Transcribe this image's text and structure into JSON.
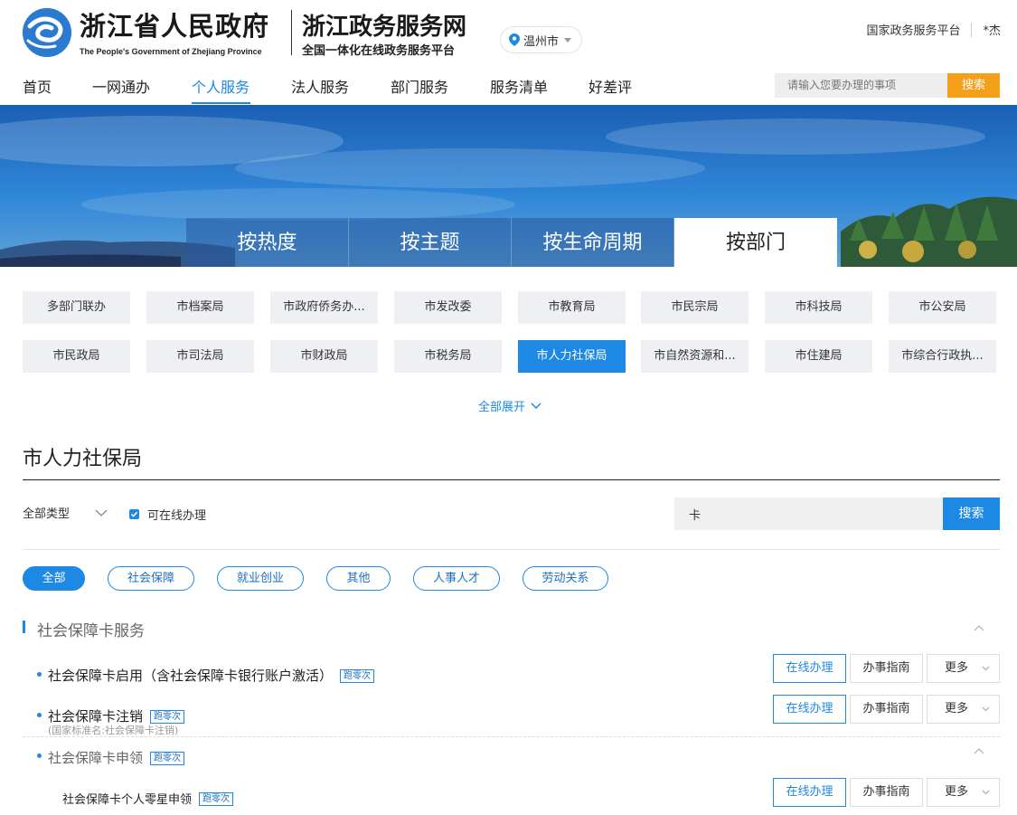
{
  "header": {
    "gov_name": "浙江省人民政府",
    "gov_name_en": "The People's Government of Zhejiang Province",
    "site_name": "浙江政务服务网",
    "site_slogan": "全国一体化在线政务服务平台",
    "city": "温州市",
    "links": [
      "国家政务服务平台",
      "*杰"
    ]
  },
  "nav": {
    "items": [
      "首页",
      "一网通办",
      "个人服务",
      "法人服务",
      "部门服务",
      "服务清单",
      "好差评"
    ],
    "active": "个人服务",
    "search_placeholder": "请输入您要办理的事项",
    "search_button": "搜索"
  },
  "banner_tabs": [
    "按热度",
    "按主题",
    "按生命周期",
    "按部门"
  ],
  "banner_active": "按部门",
  "departments": [
    "多部门联办",
    "市档案局",
    "市政府侨务办...",
    "市发改委",
    "市教育局",
    "市民宗局",
    "市科技局",
    "市公安局",
    "市民政局",
    "市司法局",
    "市财政局",
    "市税务局",
    "市人力社保局",
    "市自然资源和...",
    "市住建局",
    "市综合行政执..."
  ],
  "departments_active": "市人力社保局",
  "expand_all": "全部展开",
  "section": {
    "title": "市人力社保局",
    "type_filter": "全部类型",
    "online_only": "可在线办理",
    "keyword": "卡",
    "search_button": "搜索",
    "categories": [
      "全部",
      "社会保障",
      "就业创业",
      "其他",
      "人事人才",
      "劳动关系"
    ],
    "category_active": "全部"
  },
  "group": {
    "title": "社会保障卡服务",
    "items": [
      {
        "title": "社会保障卡启用（含社会保障卡银行账户激活）",
        "tag": "跑零次",
        "note": ""
      },
      {
        "title": "社会保障卡注销",
        "tag": "跑零次",
        "note": "(国家标准名:社会保障卡注销)"
      },
      {
        "title": "社会保障卡申领",
        "tag": "跑零次",
        "note": ""
      }
    ],
    "sub_item": {
      "title": "社会保障卡个人零星申领",
      "tag": "跑零次"
    }
  },
  "actions": {
    "online": "在线办理",
    "guide": "办事指南",
    "more": "更多"
  },
  "colors": {
    "primary": "#1e88e5",
    "search_orange": "#f5a01b",
    "dept_bg": "#eef0f3"
  }
}
